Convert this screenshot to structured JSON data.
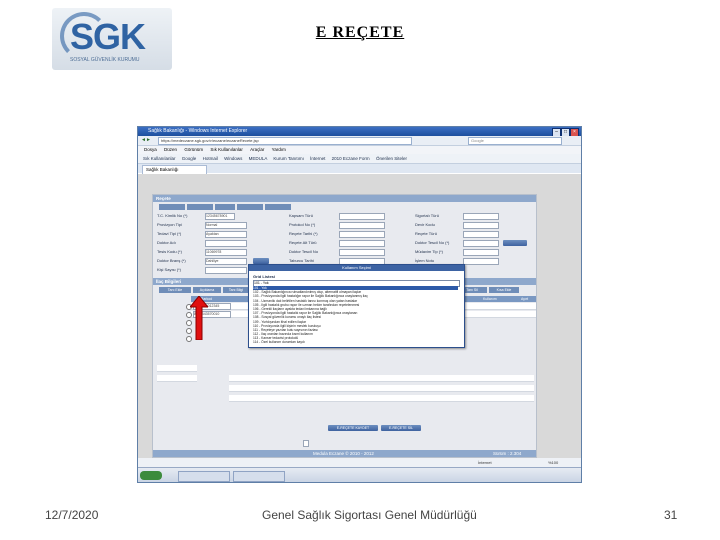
{
  "slide": {
    "title": "E REÇETE",
    "date": "12/7/2020",
    "footer": "Genel Sağlık Sigortası Genel Müdürlüğü",
    "page_number": "31"
  },
  "logo": {
    "text": "SGK",
    "sub": "SOSYAL GÜVENLİK KURUMU"
  },
  "browser": {
    "title": "Sağlık Bakanlığı - Windows Internet Explorer",
    "address": "https://medeczane.sgk.gov.tr/eczane/eczaneRecete.jsp",
    "search_placeholder": "Google",
    "menu": [
      "Dosya",
      "Düzen",
      "Görünüm",
      "Sık Kullanılanlar",
      "Araçlar",
      "Yardım"
    ],
    "links": [
      "Sık Kullanılanlar",
      "Google",
      "Hotmail",
      "Windows",
      "MEDULA",
      "Kurum Tanıtımı",
      "İnternet",
      "2010 Eczane Form",
      "Önerilen Siteler"
    ],
    "tab_label": "Sağlık Bakanlığı",
    "status": "İnternet",
    "zoom": "%100"
  },
  "form": {
    "section_recete": "Reçete",
    "section_ilac": "İlaç Bilgileri",
    "labels_col1": [
      "T.C. Kimlik No (*)",
      "Provizyon Tipi",
      "Tedavi Tipi (*)",
      "Doktor Adı",
      "Tesis Kodu (*)",
      "Doktor Branş (*)",
      "Kişi Sayısı (*)"
    ],
    "labels_col2": [
      "Kapsam Türü",
      "Protokol No (*)",
      "Reçete Tarihi (*)",
      "Reçete Alt Türü",
      "Doktor Tescil No",
      "Taburcu Tarihi"
    ],
    "labels_col3": [
      "Sigortalı Türü",
      "Devir Kodu",
      "Reçete Türü",
      "Doktor Tescil No (*)",
      "Müdavim Tip (*)",
      "İşlem Notu"
    ],
    "values_col1": [
      "12345678901",
      "Normal",
      "Ayaktan",
      "",
      "11069978",
      "Dahiliye"
    ],
    "tabs": [
      "Tanı Ekle",
      "Açıklama",
      "Tanı Bilgi",
      "Sil",
      "İlaç Ara",
      "İlaç Sil",
      "Kaydet"
    ],
    "grid_cols": [
      "Barkod",
      "Adet / Doz / Periyot",
      "Kutu",
      "Tutar",
      "Fark",
      "Kullanım",
      "Ayırt"
    ],
    "grid_rows": [
      "8699525012345",
      "8699543570010"
    ],
    "side_tabs": [
      "Bilgi Ekle",
      "Tanı Sil",
      "Kısa Ekle"
    ],
    "buttons_bottom": [
      "E-REÇETE KAYDET",
      "E-REÇETE SİL"
    ],
    "footer_version": "Sürüm : 2.304",
    "footer_copy": "Medula Eczane © 2010 - 2012"
  },
  "popup": {
    "title": "Kullanım Seçimi",
    "label": "Grid Listesi",
    "selected": "101 - Yok",
    "options": [
      "101 - Yok",
      "102 - Sağlık Bakanlığınca ruhsatlandırılmış olup, alternatifi olmayan ilaçlar",
      "103 - Provizyonda ilgili hastalığın rapor ile Sağlık Bakanlığınca onaylanmış ilaç",
      "104 - Uzmanlık dalı belirtilen hastalık tanısı konmuş olan yatan hastalar",
      "105 - İlgili hastalık grubu rapor ile uzman hekim tarafından reçetelenmesi",
      "106 - Gerekli ilaçların ayakta tedavi imkanına bağlı",
      "107 - Provizyonda ilgili hastalık rapor ile Sağlık Bakanlığınca onaylanan",
      "108 - Sosyal güvenlik kurumu onaylı ilaç listesi",
      "109 - Yurtdışından ithal edilen ilaçlar",
      "110 - Provizyonda ilgili kişinin meslek kuruluşu",
      "111 - Reçeteye yazılan kutu sayısının fazlası",
      "112 - İlaç oranları bazında kısmi kullanım",
      "113 - Kanser tedavisi protokolü",
      "114 - Özel kullanım durumları kaydı",
      "115 - Sağlık Bakanlığınca onaylı yazılı olmayan",
      "116 - Hekim tarafından yazılan kullanım notu"
    ]
  }
}
